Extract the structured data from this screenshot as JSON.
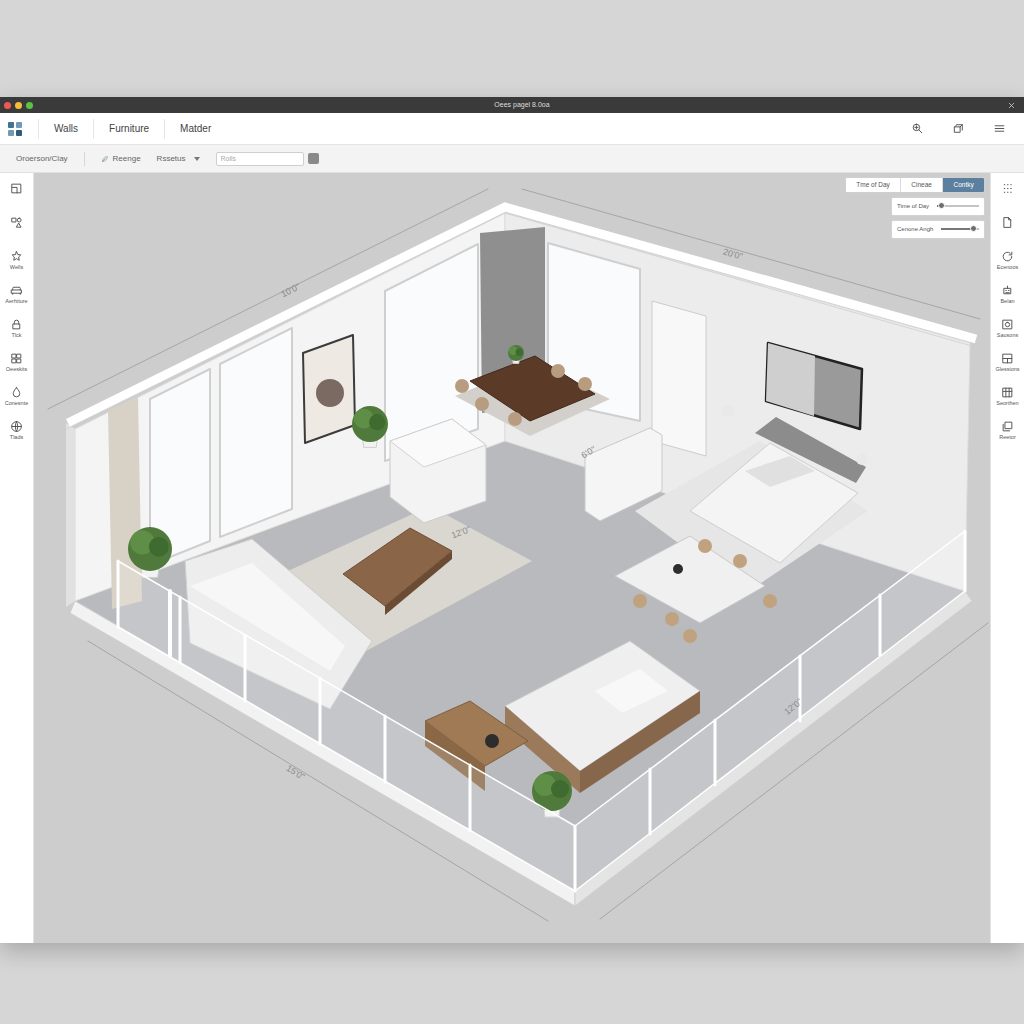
{
  "window": {
    "title": "Oees pagel 8.0oa"
  },
  "toolbar": {
    "tabs": [
      {
        "label": "Walls",
        "selected": false
      },
      {
        "label": "Furniture",
        "selected": false
      },
      {
        "label": "Matder",
        "selected": false
      }
    ]
  },
  "subbar": {
    "project": "Oroerson/Clay",
    "items": [
      {
        "label": "Reenge",
        "kind": "iconlabel"
      },
      {
        "label": "Rssetus",
        "kind": "dropdown"
      }
    ],
    "search": {
      "placeholder": "Rolls"
    }
  },
  "left_sidebar": {
    "items": [
      {
        "kind": "icon"
      },
      {
        "kind": "icon"
      },
      {
        "kind": "labeled",
        "label": "Wells"
      },
      {
        "kind": "labeled",
        "label": "Aerhiture"
      },
      {
        "kind": "labeled",
        "label": "Tlck"
      },
      {
        "kind": "labeled",
        "label": "Oeeskits"
      },
      {
        "kind": "labeled",
        "label": "Conesnte"
      },
      {
        "kind": "labeled",
        "label": "Tlads"
      }
    ]
  },
  "right_sidebar": {
    "items": [
      {
        "kind": "icon"
      },
      {
        "kind": "icon"
      },
      {
        "kind": "labeled",
        "label": "Ecenoos"
      },
      {
        "kind": "labeled",
        "label": "Belan"
      },
      {
        "kind": "labeled",
        "label": "Sausons"
      },
      {
        "kind": "labeled",
        "label": "Glessions"
      },
      {
        "kind": "labeled",
        "label": "Seorthen"
      },
      {
        "kind": "labeled",
        "label": "Reetor"
      }
    ]
  },
  "scene_panel": {
    "modes": [
      {
        "label": "Tme of Day",
        "selected": false
      },
      {
        "label": "Cineae",
        "selected": false
      },
      {
        "label": "Contky",
        "selected": true
      }
    ],
    "sliders": [
      {
        "label": "Time of Day",
        "level": 0.1
      },
      {
        "label": "Cenone Angh",
        "level": 0.85
      }
    ]
  },
  "canvas": {
    "dimensions": [
      "10'0\"",
      "20'0\"",
      "12'0\"",
      "15'0\"",
      "12'0\"",
      "6'0\""
    ]
  }
}
